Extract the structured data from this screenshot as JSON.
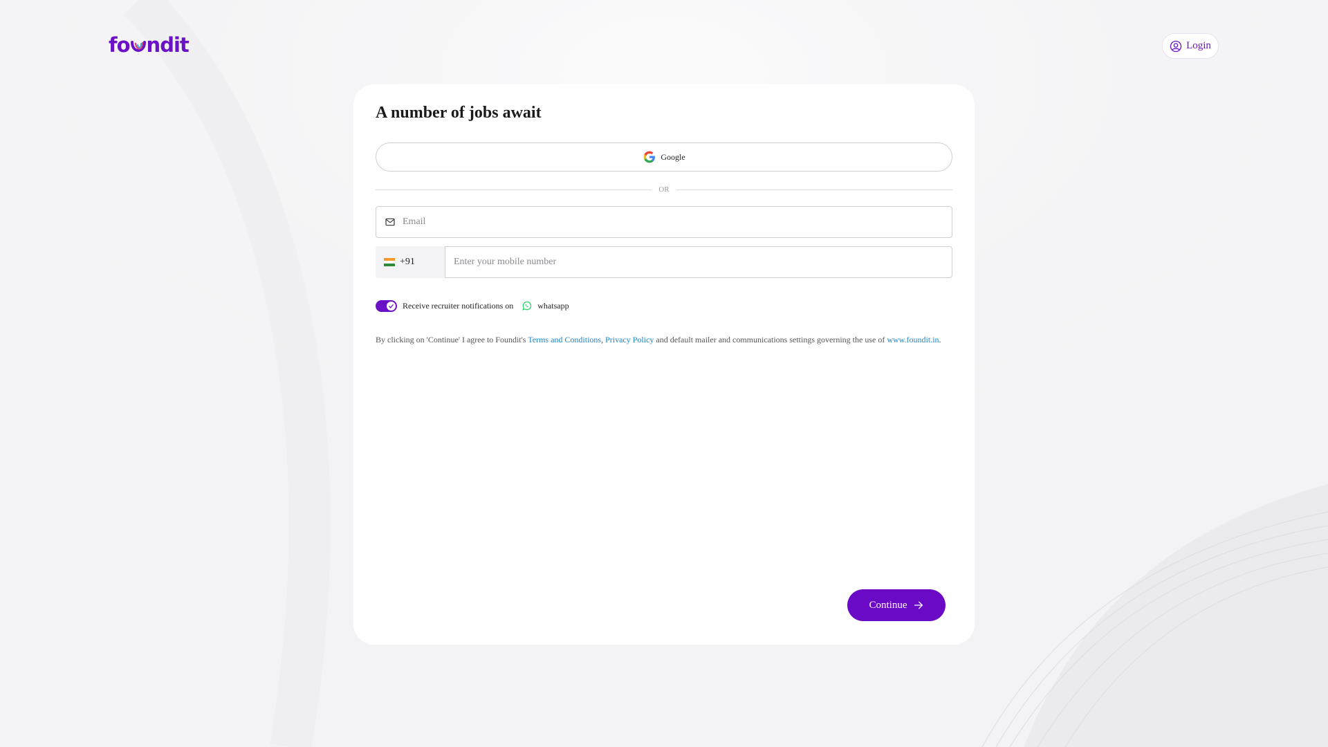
{
  "header": {
    "logo_text_left": "fo",
    "logo_text_right": "ndit",
    "login_label": "Login"
  },
  "card": {
    "title": "A number of jobs await",
    "google_label": "Google",
    "or_label": "OR",
    "email_placeholder": "Email",
    "country_code": "+91",
    "mobile_placeholder": "Enter your mobile number",
    "whatsapp_toggle_on": true,
    "toggle_label": "Receive recruiter notifications on",
    "whatsapp_label": "whatsapp",
    "terms": {
      "prefix": "By clicking on 'Continue' I agree to Foundit's ",
      "terms_link": "Terms and Conditions",
      "comma": ", ",
      "privacy_link": "Privacy Policy",
      "middle": " and default mailer and communications settings governing the use of ",
      "site_link": "www.foundit.in",
      "suffix": "."
    },
    "continue_label": "Continue"
  },
  "colors": {
    "brand": "#6b12c6",
    "link": "#1a86c7",
    "whatsapp": "#25d366"
  },
  "icons": [
    "user-circle-icon",
    "google-icon",
    "mail-icon",
    "india-flag-icon",
    "check-icon",
    "whatsapp-icon",
    "arrow-right-icon"
  ]
}
